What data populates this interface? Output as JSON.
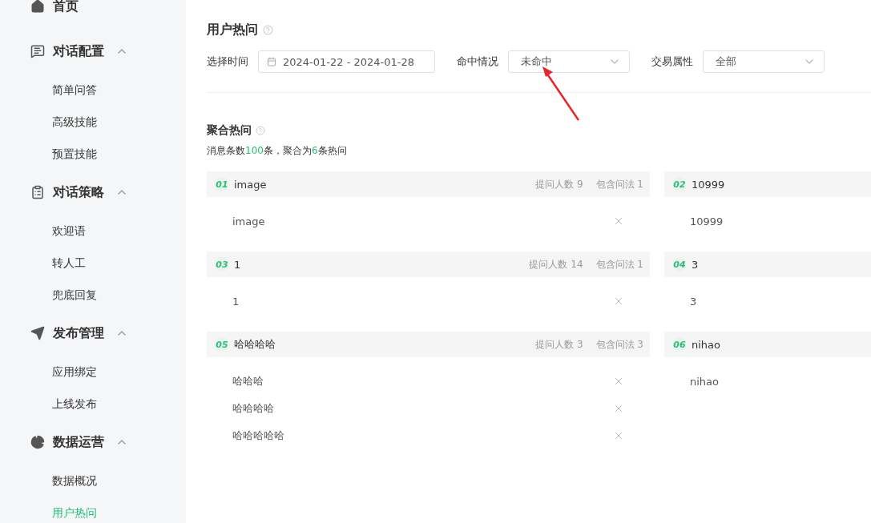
{
  "sidebar": {
    "groups": [
      {
        "label": "首页"
      },
      {
        "label": "对话配置",
        "expanded": true,
        "items": [
          {
            "label": "简单问答",
            "selected": false
          },
          {
            "label": "高级技能",
            "selected": false
          },
          {
            "label": "预置技能",
            "selected": false
          }
        ]
      },
      {
        "label": "对话策略",
        "expanded": true,
        "items": [
          {
            "label": "欢迎语",
            "selected": false
          },
          {
            "label": "转人工",
            "selected": false
          },
          {
            "label": "兜底回复",
            "selected": false
          }
        ]
      },
      {
        "label": "发布管理",
        "expanded": true,
        "items": [
          {
            "label": "应用绑定",
            "selected": false
          },
          {
            "label": "上线发布",
            "selected": false
          }
        ]
      },
      {
        "label": "数据运营",
        "expanded": true,
        "items": [
          {
            "label": "数据概况",
            "selected": false
          },
          {
            "label": "用户热问",
            "selected": true
          }
        ]
      }
    ]
  },
  "page_title": "用户热问",
  "filters": [
    {
      "kind": "date",
      "label": "选择时间",
      "value": "2024-01-22 - 2024-01-28"
    },
    {
      "kind": "select",
      "label": "命中情况",
      "value": "未命中"
    },
    {
      "kind": "select",
      "label": "交易属性",
      "value": "全部"
    }
  ],
  "section_title": "聚合热问",
  "summary": [
    {
      "text": "消息条数",
      "highlight": false
    },
    {
      "text": "100",
      "highlight": true
    },
    {
      "text": "条，聚合为",
      "highlight": false
    },
    {
      "text": "6",
      "highlight": true
    },
    {
      "text": "条热问",
      "highlight": false
    }
  ],
  "cards": [
    {
      "index": "01",
      "title": "image",
      "stats": [
        "提问人数 9",
        "包含问法 1"
      ],
      "rows": [
        {
          "text": "image",
          "removable": true
        }
      ]
    },
    {
      "index": "02",
      "title": "10999",
      "rows": [
        {
          "text": "10999",
          "removable": false
        }
      ]
    },
    {
      "index": "03",
      "title": "1",
      "stats": [
        "提问人数 14",
        "包含问法 1"
      ],
      "rows": [
        {
          "text": "1",
          "removable": true
        }
      ]
    },
    {
      "index": "04",
      "title": "3",
      "rows": [
        {
          "text": "3",
          "removable": false
        }
      ]
    },
    {
      "index": "05",
      "title": "哈哈哈哈",
      "stats": [
        "提问人数 3",
        "包含问法 3"
      ],
      "rows": [
        {
          "text": "哈哈哈",
          "removable": true
        },
        {
          "text": "哈哈哈哈",
          "removable": true
        },
        {
          "text": "哈哈哈哈哈",
          "removable": true
        }
      ]
    },
    {
      "index": "06",
      "title": "nihao",
      "rows": [
        {
          "text": "nihao",
          "removable": false
        }
      ]
    }
  ]
}
